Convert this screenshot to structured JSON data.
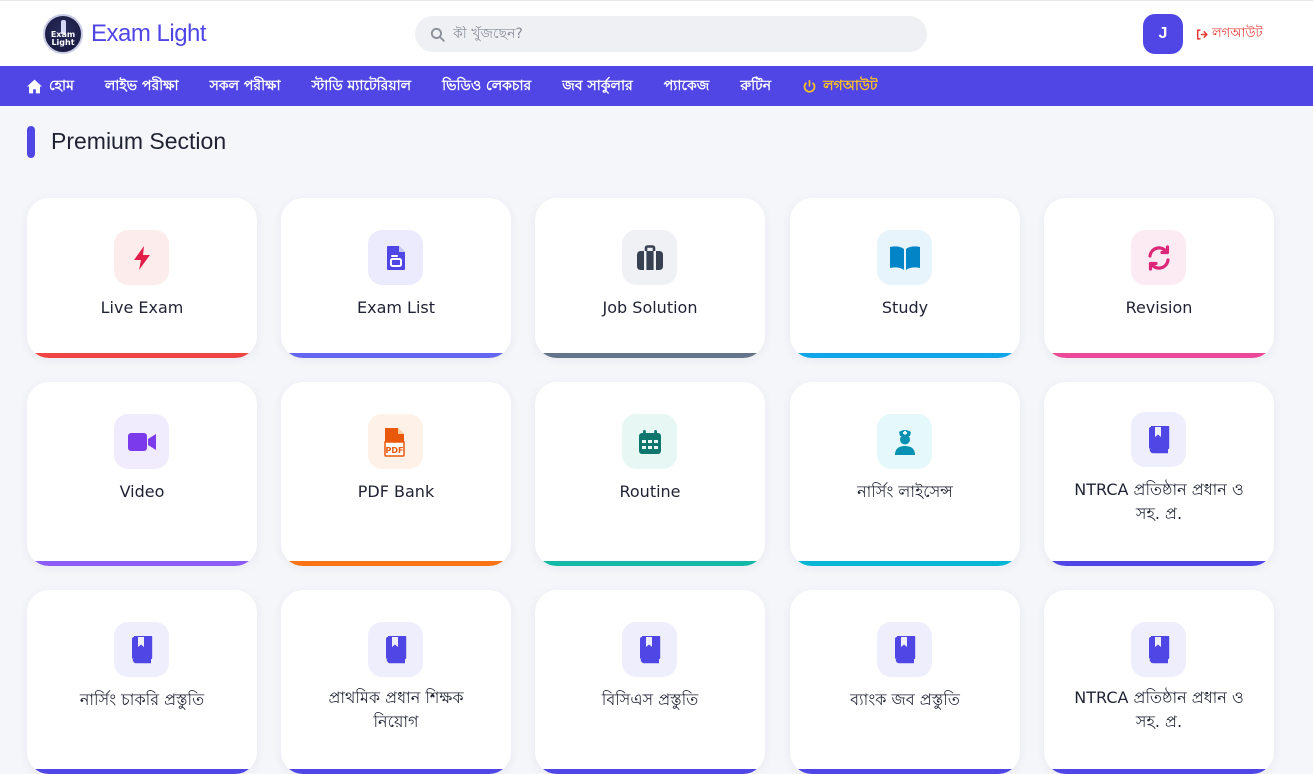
{
  "brand": {
    "logo_text": "Exam Light",
    "name": "Exam Light"
  },
  "search": {
    "placeholder": "কী খুঁজছেন?"
  },
  "user": {
    "initial": "J",
    "logout_label": "লগআউট"
  },
  "nav": {
    "items": [
      {
        "label": "হোম"
      },
      {
        "label": "লাইভ পরীক্ষা"
      },
      {
        "label": "সকল পরীক্ষা"
      },
      {
        "label": "স্টাডি ম্যাটেরিয়াল"
      },
      {
        "label": "ভিডিও লেকচার"
      },
      {
        "label": "জব সার্কুলার"
      },
      {
        "label": "প্যাকেজ"
      },
      {
        "label": "রুটিন"
      },
      {
        "label": "লগআউট"
      }
    ]
  },
  "section": {
    "title": "Premium Section"
  },
  "cards": [
    {
      "label": "Live Exam",
      "icon": "bolt-icon",
      "accent": "#ef4444",
      "bg": "#fdecec",
      "color": "#e11d48"
    },
    {
      "label": "Exam List",
      "icon": "document-list-icon",
      "accent": "#6366f1",
      "bg": "#ebebfd",
      "color": "#4f46e5"
    },
    {
      "label": "Job Solution",
      "icon": "briefcase-icon",
      "accent": "#64748b",
      "bg": "#f0f1f4",
      "color": "#374151"
    },
    {
      "label": "Study",
      "icon": "open-book-icon",
      "accent": "#0ea5e9",
      "bg": "#e7f4fb",
      "color": "#0284c7"
    },
    {
      "label": "Revision",
      "icon": "sync-icon",
      "accent": "#ec4899",
      "bg": "#fdebf3",
      "color": "#db2777"
    },
    {
      "label": "Video",
      "icon": "video-camera-icon",
      "accent": "#8b5cf6",
      "bg": "#f1ecfd",
      "color": "#7c3aed"
    },
    {
      "label": "PDF Bank",
      "icon": "pdf-file-icon",
      "accent": "#f97316",
      "bg": "#fef1e7",
      "color": "#ea580c"
    },
    {
      "label": "Routine",
      "icon": "calendar-icon",
      "accent": "#14b8a6",
      "bg": "#e6f7f4",
      "color": "#0f766e"
    },
    {
      "label": "নার্সিং লাইসেন্স",
      "icon": "nurse-icon",
      "accent": "#06b6d4",
      "bg": "#e5f8fb",
      "color": "#0891b2"
    },
    {
      "label": "NTRCA প্রতিষ্ঠান প্রধান ও সহ. প্র.",
      "icon": "bookmark-book-icon",
      "accent": "#4f46e5",
      "bg": "#eeeefc",
      "color": "#4f46e5"
    },
    {
      "label": "নার্সিং চাকরি প্রস্তুতি",
      "icon": "bookmark-book-icon",
      "accent": "#4f46e5",
      "bg": "#eeeefc",
      "color": "#4f46e5"
    },
    {
      "label": "প্রাথমিক প্রধান শিক্ষক নিয়োগ",
      "icon": "bookmark-book-icon",
      "accent": "#4f46e5",
      "bg": "#eeeefc",
      "color": "#4f46e5"
    },
    {
      "label": "বিসিএস প্রস্তুতি",
      "icon": "bookmark-book-icon",
      "accent": "#4f46e5",
      "bg": "#eeeefc",
      "color": "#4f46e5"
    },
    {
      "label": "ব্যাংক জব প্রস্তুতি",
      "icon": "bookmark-book-icon",
      "accent": "#4f46e5",
      "bg": "#eeeefc",
      "color": "#4f46e5"
    },
    {
      "label": "NTRCA প্রতিষ্ঠান প্রধান ও সহ. প্র.",
      "icon": "bookmark-book-icon",
      "accent": "#4f46e5",
      "bg": "#eeeefc",
      "color": "#4f46e5"
    }
  ]
}
